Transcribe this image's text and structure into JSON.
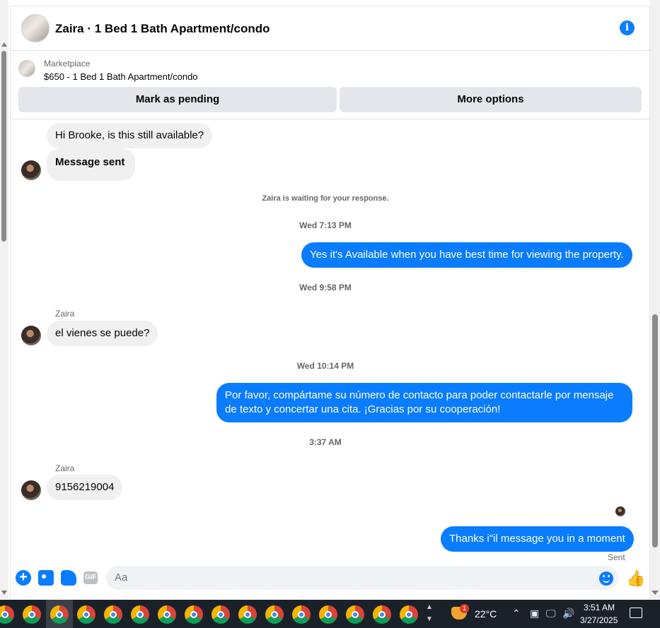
{
  "header": {
    "title": "Zaira · 1 Bed 1 Bath Apartment/condo"
  },
  "listing": {
    "source": "Marketplace",
    "price_title": "$650 - 1 Bed 1 Bath Apartment/condo",
    "mark_pending": "Mark as pending",
    "more_options": "More options"
  },
  "messages": {
    "m1": "Hi Brooke, is this still available?",
    "m2": "Message sent",
    "waiting": "Zaira is waiting for your response.",
    "t1": "Wed 7:13 PM",
    "m3": "Yes it's Available when you have best time for viewing the property.",
    "t2": "Wed 9:58 PM",
    "sender1": "Zaira",
    "m4": "el vienes se puede?",
    "t3": "Wed 10:14 PM",
    "m5": "Por favor, compártame su número de contacto para poder contactarle por mensaje de texto y concertar una cita. ¡Gracias por su cooperación!",
    "t4": "3:37 AM",
    "sender2": "Zaira",
    "m6": "9156219004",
    "m7": "Thanks i\"il message you in a moment",
    "status": "Sent"
  },
  "composer": {
    "placeholder": "Aa",
    "gif": "GIF"
  },
  "taskbar": {
    "weather_badge": "1",
    "temperature": "22°C",
    "time": "3:51 AM",
    "date": "3/27/2025"
  }
}
